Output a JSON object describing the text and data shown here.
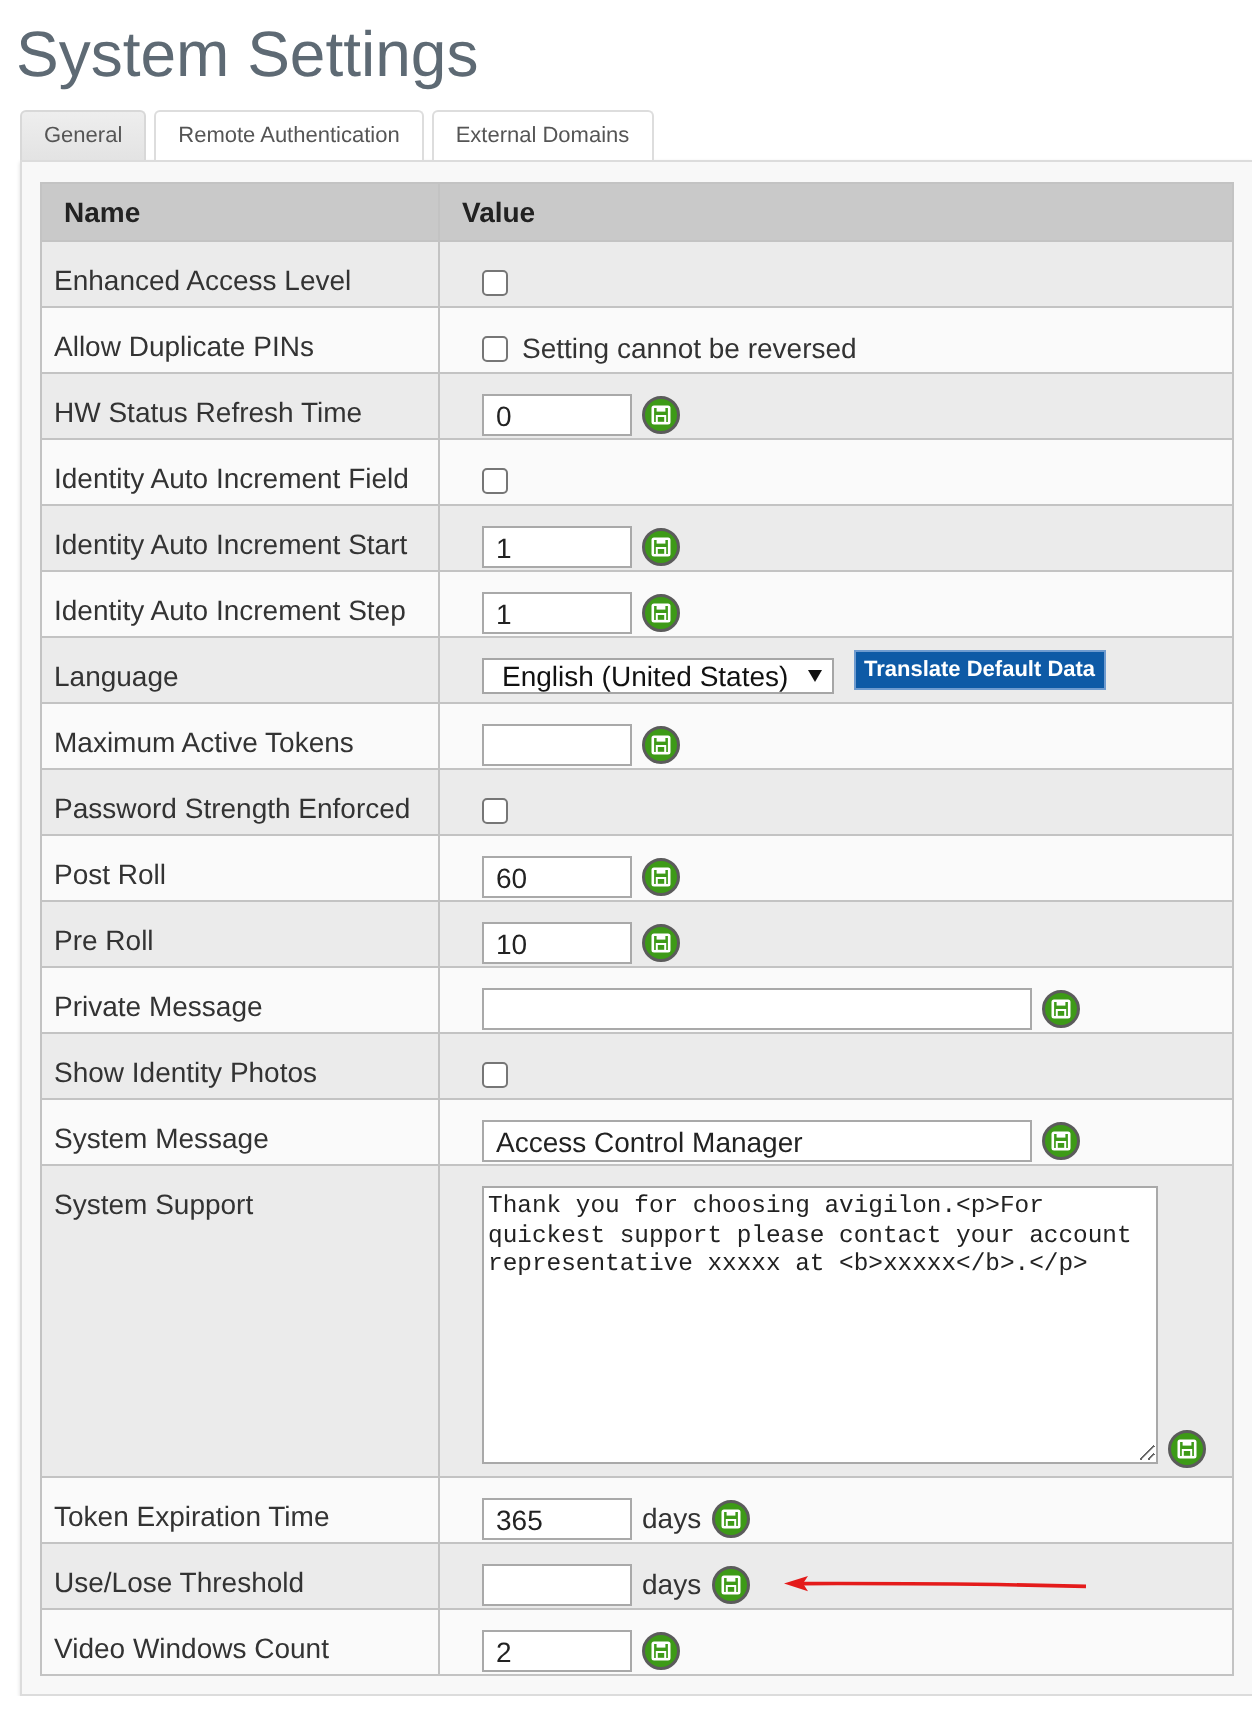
{
  "page": {
    "title": "System Settings"
  },
  "tabs": [
    {
      "label": "General",
      "selected": true
    },
    {
      "label": "Remote Authentication",
      "selected": false
    },
    {
      "label": "External Domains",
      "selected": false
    }
  ],
  "table": {
    "columns": [
      "Name",
      "Value"
    ],
    "rows": [
      {
        "name": "Enhanced Access Level",
        "kind": "checkbox",
        "checked": false,
        "arrow": false
      },
      {
        "name": "Allow Duplicate PINs",
        "kind": "checkbox",
        "checked": false,
        "note": "Setting cannot be reversed",
        "arrow": false
      },
      {
        "name": "HW Status Refresh Time",
        "kind": "number",
        "value": "0",
        "arrow": false
      },
      {
        "name": "Identity Auto Increment Field",
        "kind": "checkbox",
        "checked": false,
        "arrow": false
      },
      {
        "name": "Identity Auto Increment Start",
        "kind": "number",
        "value": "1",
        "arrow": false
      },
      {
        "name": "Identity Auto Increment Step",
        "kind": "number",
        "value": "1",
        "arrow": false
      },
      {
        "name": "Language",
        "kind": "select",
        "value": "English (United States)",
        "button": "Translate Default Data",
        "arrow": false
      },
      {
        "name": "Maximum Active Tokens",
        "kind": "number",
        "arrow": false
      },
      {
        "name": "Password Strength Enforced",
        "kind": "checkbox",
        "checked": false,
        "arrow": false
      },
      {
        "name": "Post Roll",
        "kind": "number",
        "value": "60",
        "arrow": false
      },
      {
        "name": "Pre Roll",
        "kind": "number",
        "value": "10",
        "arrow": false
      },
      {
        "name": "Private Message",
        "kind": "text",
        "arrow": false
      },
      {
        "name": "Show Identity Photos",
        "kind": "checkbox",
        "checked": false,
        "arrow": false
      },
      {
        "name": "System Message",
        "kind": "text",
        "value": "Access Control Manager",
        "arrow": false
      },
      {
        "name": "System Support",
        "kind": "textarea",
        "value": "Thank you for choosing avigilon.<p>For quickest support please contact your account representative xxxxx at <b>xxxxx</b>.</p>",
        "arrow": false
      },
      {
        "name": "Token Expiration Time",
        "kind": "number",
        "value": "365",
        "unit": "days",
        "arrow": false
      },
      {
        "name": "Use/Lose Threshold",
        "kind": "number",
        "unit": "days",
        "arrow": true
      },
      {
        "name": "Video Windows Count",
        "kind": "number",
        "value": "2",
        "arrow": false
      }
    ]
  }
}
